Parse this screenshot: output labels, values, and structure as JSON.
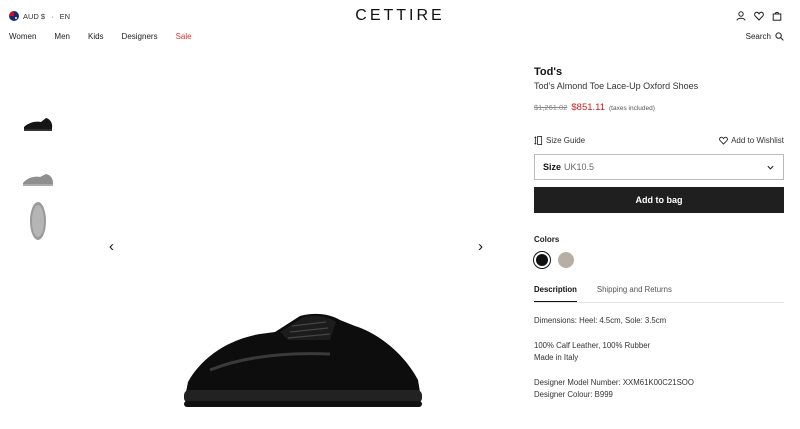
{
  "header": {
    "currency": "AUD $",
    "separator": "·",
    "language": "EN",
    "logo": "CETTIRE",
    "icons": [
      "account-icon",
      "wishlist-icon",
      "bag-icon"
    ]
  },
  "nav": {
    "items": [
      "Women",
      "Men",
      "Kids",
      "Designers",
      "Sale"
    ],
    "search_label": "Search"
  },
  "gallery": {
    "prev": "‹",
    "next": "›"
  },
  "product": {
    "brand": "Tod's",
    "name": "Tod's Almond Toe Lace-Up Oxford Shoes",
    "old_price": "$1,261.02",
    "price": "$851.11",
    "tax_note": "(taxes included)",
    "size_guide": "Size Guide",
    "wishlist": "Add to Wishlist",
    "size_label": "Size",
    "size_value": "UK10.5",
    "add_to_bag": "Add to bag",
    "colors_label": "Colors",
    "colors": [
      "#111111",
      "#b7afa6"
    ],
    "tabs": [
      "Description",
      "Shipping and Returns"
    ],
    "description": {
      "dimensions": "Dimensions: Heel: 4.5cm, Sole: 3.5cm",
      "material": "100% Calf Leather, 100% Rubber",
      "origin": "Made in Italy",
      "model_number": "Designer Model Number: XXM61K00C21SOO",
      "colour": "Designer Colour: B999"
    }
  }
}
